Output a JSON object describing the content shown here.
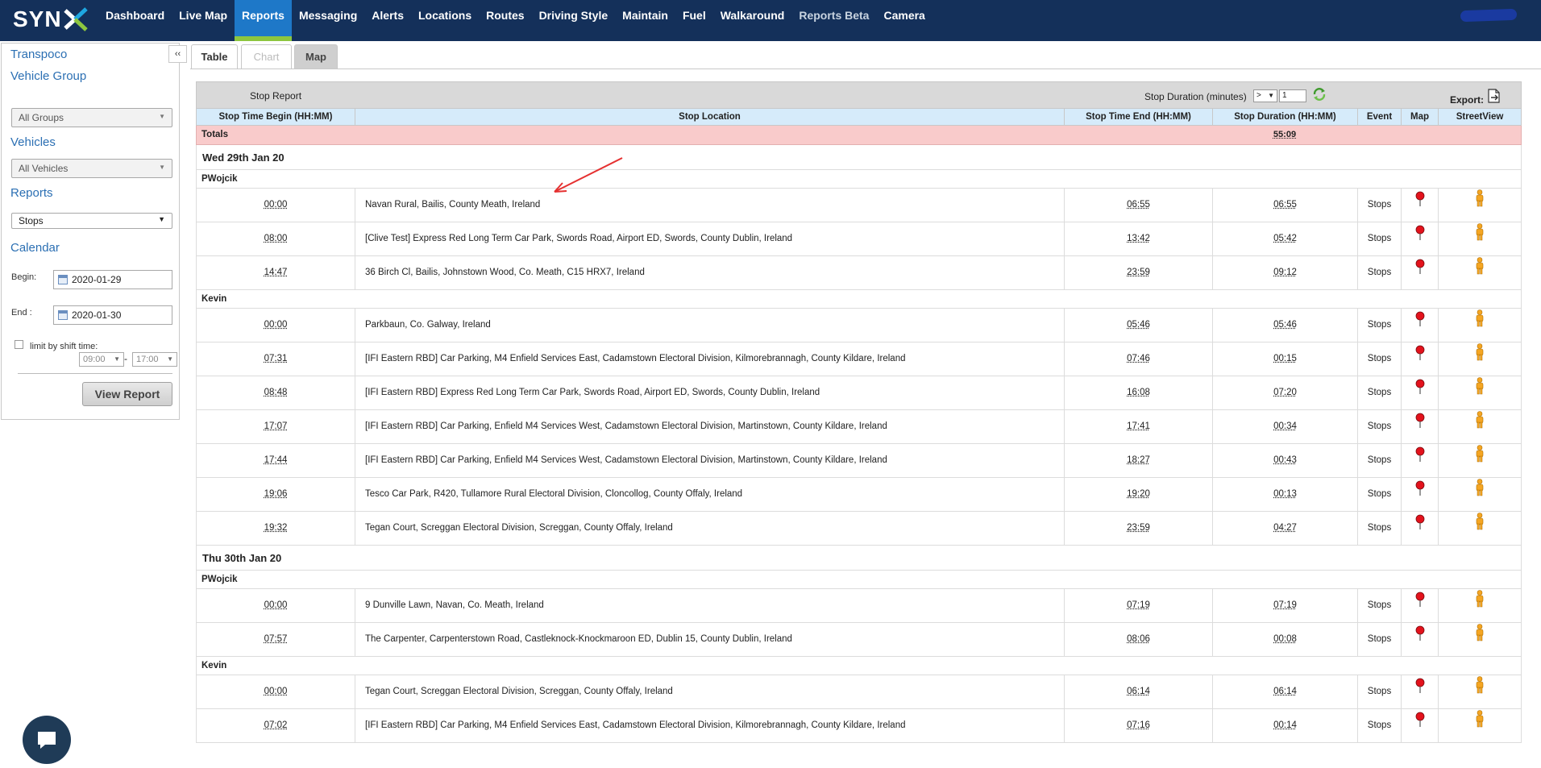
{
  "brand": {
    "logo_text": "SYN"
  },
  "nav": [
    {
      "label": "Dashboard",
      "state": "normal"
    },
    {
      "label": "Live Map",
      "state": "normal"
    },
    {
      "label": "Reports",
      "state": "active"
    },
    {
      "label": "Messaging",
      "state": "normal"
    },
    {
      "label": "Alerts",
      "state": "normal"
    },
    {
      "label": "Locations",
      "state": "normal"
    },
    {
      "label": "Routes",
      "state": "normal"
    },
    {
      "label": "Driving Style",
      "state": "normal"
    },
    {
      "label": "Maintain",
      "state": "normal"
    },
    {
      "label": "Fuel",
      "state": "normal"
    },
    {
      "label": "Walkaround",
      "state": "normal"
    },
    {
      "label": "Reports Beta",
      "state": "dim"
    },
    {
      "label": "Camera",
      "state": "normal"
    }
  ],
  "sidebar": {
    "collapse_label": "‹‹",
    "company": "Transpoco",
    "vehicle_group_heading": "Vehicle Group",
    "vehicle_group_value": "All Groups",
    "vehicles_heading": "Vehicles",
    "vehicles_value": "All Vehicles",
    "reports_heading": "Reports",
    "report_type_value": "Stops",
    "calendar_heading": "Calendar",
    "begin_label": "Begin:",
    "begin_value": "2020-01-29",
    "end_label": "End :",
    "end_value": "2020-01-30",
    "shift_label": "limit by shift time:",
    "shift_start": "09:00",
    "shift_end": "17:00",
    "shift_dash": "-",
    "view_report_label": "View Report"
  },
  "tabs": [
    {
      "label": "Table",
      "state": "active"
    },
    {
      "label": "Chart",
      "state": "disabled"
    },
    {
      "label": "Map",
      "state": "normal"
    }
  ],
  "report": {
    "title": "Stop Report",
    "stop_duration_label": "Stop Duration (minutes)",
    "stop_duration_operator": ">",
    "stop_duration_value": "1",
    "export_label": "Export:",
    "columns": {
      "begin": "Stop Time Begin (HH:MM)",
      "location": "Stop Location",
      "end": "Stop Time End (HH:MM)",
      "duration": "Stop Duration (HH:MM)",
      "event": "Event",
      "map": "Map",
      "streetview": "StreetView"
    },
    "totals_label": "Totals",
    "totals_duration": "55:09",
    "days": [
      {
        "label": "Wed 29th Jan 20",
        "drivers": [
          {
            "name": "PWojcik",
            "stops": [
              {
                "begin": "00:00",
                "location": "Navan Rural, Bailis, County Meath, Ireland",
                "end": "06:55",
                "duration": "06:55",
                "event": "Stops"
              },
              {
                "begin": "08:00",
                "location": "[Clive Test] Express Red Long Term Car Park, Swords Road, Airport ED, Swords, County Dublin, Ireland",
                "end": "13:42",
                "duration": "05:42",
                "event": "Stops"
              },
              {
                "begin": "14:47",
                "location": "36 Birch Cl, Bailis, Johnstown Wood, Co. Meath, C15 HRX7, Ireland",
                "end": "23:59",
                "duration": "09:12",
                "event": "Stops"
              }
            ]
          },
          {
            "name": "Kevin",
            "stops": [
              {
                "begin": "00:00",
                "location": "Parkbaun, Co. Galway, Ireland",
                "end": "05:46",
                "duration": "05:46",
                "event": "Stops"
              },
              {
                "begin": "07:31",
                "location": "[IFI Eastern RBD] Car Parking, M4 Enfield Services East, Cadamstown Electoral Division, Kilmorebrannagh, County Kildare, Ireland",
                "end": "07:46",
                "duration": "00:15",
                "event": "Stops"
              },
              {
                "begin": "08:48",
                "location": "[IFI Eastern RBD] Express Red Long Term Car Park, Swords Road, Airport ED, Swords, County Dublin, Ireland",
                "end": "16:08",
                "duration": "07:20",
                "event": "Stops"
              },
              {
                "begin": "17:07",
                "location": "[IFI Eastern RBD] Car Parking, Enfield M4 Services West, Cadamstown Electoral Division, Martinstown, County Kildare, Ireland",
                "end": "17:41",
                "duration": "00:34",
                "event": "Stops"
              },
              {
                "begin": "17:44",
                "location": "[IFI Eastern RBD] Car Parking, Enfield M4 Services West, Cadamstown Electoral Division, Martinstown, County Kildare, Ireland",
                "end": "18:27",
                "duration": "00:43",
                "event": "Stops"
              },
              {
                "begin": "19:06",
                "location": "Tesco Car Park, R420, Tullamore Rural Electoral Division, Cloncollog, County Offaly, Ireland",
                "end": "19:20",
                "duration": "00:13",
                "event": "Stops"
              },
              {
                "begin": "19:32",
                "location": "Tegan Court, Screggan Electoral Division, Screggan, County Offaly, Ireland",
                "end": "23:59",
                "duration": "04:27",
                "event": "Stops"
              }
            ]
          }
        ]
      },
      {
        "label": "Thu 30th Jan 20",
        "drivers": [
          {
            "name": "PWojcik",
            "stops": [
              {
                "begin": "00:00",
                "location": "9 Dunville Lawn, Navan, Co. Meath, Ireland",
                "end": "07:19",
                "duration": "07:19",
                "event": "Stops"
              },
              {
                "begin": "07:57",
                "location": "The Carpenter, Carpenterstown Road, Castleknock-Knockmaroon ED, Dublin 15, County Dublin, Ireland",
                "end": "08:06",
                "duration": "00:08",
                "event": "Stops"
              }
            ]
          },
          {
            "name": "Kevin",
            "stops": [
              {
                "begin": "00:00",
                "location": "Tegan Court, Screggan Electoral Division, Screggan, County Offaly, Ireland",
                "end": "06:14",
                "duration": "06:14",
                "event": "Stops"
              },
              {
                "begin": "07:02",
                "location": "[IFI Eastern RBD] Car Parking, M4 Enfield Services East, Cadamstown Electoral Division, Kilmorebrannagh, County Kildare, Ireland",
                "end": "07:16",
                "duration": "00:14",
                "event": "Stops"
              }
            ]
          }
        ]
      }
    ]
  },
  "icons": {
    "map_pin": "map-pin-icon",
    "streetview": "streetview-person-icon",
    "refresh": "refresh-icon",
    "export": "export-icon",
    "chat": "chat-icon"
  },
  "colors": {
    "topbar": "#14305a",
    "nav_active": "#1e78c8",
    "nav_active_underline": "#8dc63f",
    "column_header": "#d6ebfa",
    "totals_row": "#f9cbcb",
    "pin": "#e3121c",
    "streetview": "#f5a623",
    "annotation_arrow": "#e53030"
  }
}
